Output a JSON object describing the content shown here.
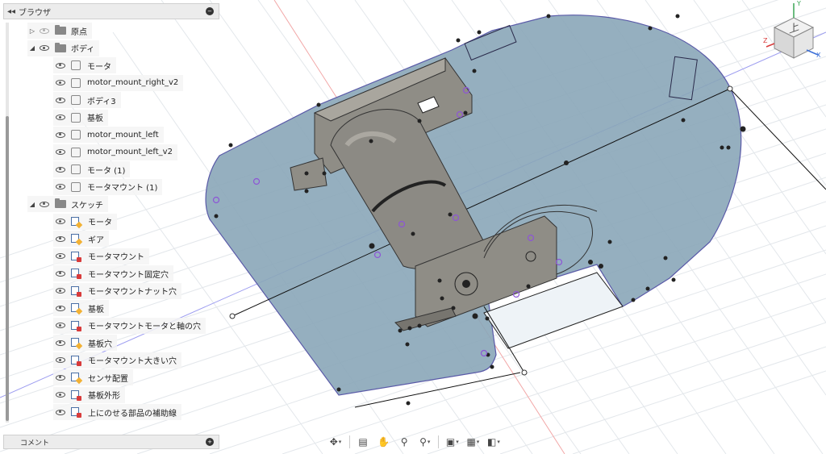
{
  "browser": {
    "title": "ブラウザ",
    "collapse_icon": "double-chevron-left-icon",
    "pin_icon": "minus-circle-icon",
    "rows": [
      {
        "label": "原点",
        "type": "folder",
        "expander": "collapsed",
        "visible": false
      },
      {
        "label": "ボディ",
        "type": "folder",
        "expander": "expanded",
        "visible": true
      },
      {
        "label": "モータ",
        "type": "body"
      },
      {
        "label": "motor_mount_right_v2",
        "type": "body"
      },
      {
        "label": "ボディ3",
        "type": "body"
      },
      {
        "label": "基板",
        "type": "body"
      },
      {
        "label": "motor_mount_left",
        "type": "body"
      },
      {
        "label": "motor_mount_left_v2",
        "type": "body"
      },
      {
        "label": "モータ (1)",
        "type": "body"
      },
      {
        "label": "モータマウント (1)",
        "type": "body"
      },
      {
        "label": "スケッチ",
        "type": "folder",
        "expander": "expanded",
        "visible": true
      },
      {
        "label": "モータ",
        "type": "sketch-edit"
      },
      {
        "label": "ギア",
        "type": "sketch-edit"
      },
      {
        "label": "モータマウント",
        "type": "sketch-lock"
      },
      {
        "label": "モータマウント固定穴",
        "type": "sketch-lock"
      },
      {
        "label": "モータマウントナット穴",
        "type": "sketch-lock"
      },
      {
        "label": "基板",
        "type": "sketch-edit"
      },
      {
        "label": "モータマウントモータと軸の穴",
        "type": "sketch-lock"
      },
      {
        "label": "基板穴",
        "type": "sketch-edit"
      },
      {
        "label": "モータマウント大きい穴",
        "type": "sketch-lock"
      },
      {
        "label": "センサ配置",
        "type": "sketch-edit"
      },
      {
        "label": "基板外形",
        "type": "sketch-lock"
      },
      {
        "label": "上にのせる部品の補助線",
        "type": "sketch-lock"
      }
    ]
  },
  "comments": {
    "title": "コメント",
    "pin_icon": "plus-circle-icon"
  },
  "toolbar": {
    "items": [
      {
        "name": "orbit",
        "glyph": "✥",
        "dropdown": true
      },
      {
        "name": "look-at",
        "glyph": "▤",
        "dropdown": false
      },
      {
        "name": "pan",
        "glyph": "✋",
        "dropdown": false
      },
      {
        "name": "zoom",
        "glyph": "⚲",
        "dropdown": false
      },
      {
        "name": "fit",
        "glyph": "⚲",
        "dropdown": true
      },
      {
        "name": "display-settings",
        "glyph": "▣",
        "dropdown": true
      },
      {
        "name": "grid-settings",
        "glyph": "▦",
        "dropdown": true
      },
      {
        "name": "viewports",
        "glyph": "◧",
        "dropdown": true
      }
    ]
  },
  "viewcube": {
    "face_label": "上",
    "axis_x": "X",
    "axis_y": "Y",
    "axis_z": "Z"
  },
  "colors": {
    "plate_fill": "#8aa6b8",
    "plate_stroke": "#5a5aa8",
    "grid": "#e2e6ea",
    "motor": "#8c8a84",
    "mount": "#8f8d86"
  }
}
